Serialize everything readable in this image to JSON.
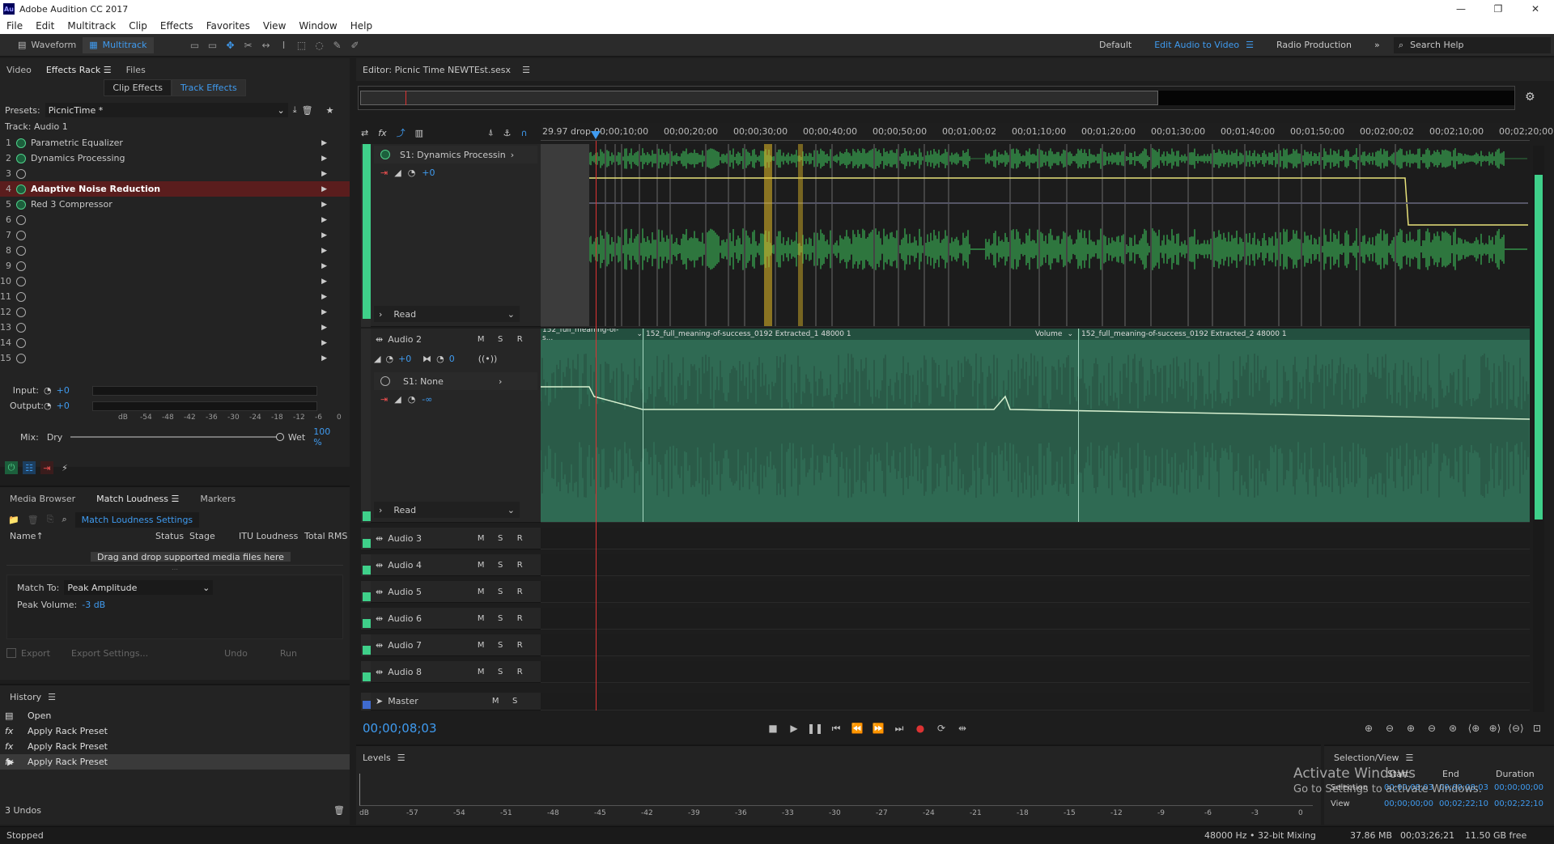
{
  "title": "Adobe Audition CC 2017",
  "window_controls": {
    "minimize": "—",
    "maximize": "❐",
    "close": "✕"
  },
  "menu": [
    "File",
    "Edit",
    "Multitrack",
    "Clip",
    "Effects",
    "Favorites",
    "View",
    "Window",
    "Help"
  ],
  "toolbar": {
    "waveform": "Waveform",
    "multitrack": "Multitrack",
    "workspaces": [
      "Default",
      "Edit Audio to Video",
      "Radio Production"
    ],
    "search_placeholder": "Search Help"
  },
  "effects_panel": {
    "tabs": [
      "Video",
      "Effects Rack",
      "Files"
    ],
    "subtabs": [
      "Clip Effects",
      "Track Effects"
    ],
    "presets_label": "Presets:",
    "preset_value": "PicnicTime *",
    "track_label": "Track: Audio 1",
    "slots": [
      {
        "n": "1",
        "name": "Parametric Equalizer",
        "on": true
      },
      {
        "n": "2",
        "name": "Dynamics Processing",
        "on": true
      },
      {
        "n": "3",
        "name": "",
        "on": false
      },
      {
        "n": "4",
        "name": "Adaptive Noise Reduction",
        "on": true,
        "selected": true
      },
      {
        "n": "5",
        "name": "Red 3 Compressor",
        "on": true
      },
      {
        "n": "6",
        "name": "",
        "on": false
      },
      {
        "n": "7",
        "name": "",
        "on": false
      },
      {
        "n": "8",
        "name": "",
        "on": false
      },
      {
        "n": "9",
        "name": "",
        "on": false
      },
      {
        "n": "10",
        "name": "",
        "on": false
      },
      {
        "n": "11",
        "name": "",
        "on": false
      },
      {
        "n": "12",
        "name": "",
        "on": false
      },
      {
        "n": "13",
        "name": "",
        "on": false
      },
      {
        "n": "14",
        "name": "",
        "on": false
      },
      {
        "n": "15",
        "name": "",
        "on": false
      }
    ],
    "input_label": "Input:",
    "input_val": "+0",
    "output_label": "Output:",
    "output_val": "+0",
    "db_scale": [
      "dB",
      "-54",
      "-48",
      "-42",
      "-36",
      "-30",
      "-24",
      "-18",
      "-12",
      "-6",
      "0"
    ],
    "mix_label": "Mix:",
    "dry": "Dry",
    "wet": "Wet",
    "wet_val": "100 %"
  },
  "loudness_panel": {
    "tabs": [
      "Media Browser",
      "Match Loudness",
      "Markers"
    ],
    "settings_btn": "Match Loudness Settings",
    "columns": [
      "Name",
      "Status",
      "Stage",
      "ITU Loudness",
      "Total RMS"
    ],
    "drop_hint": "Drag and drop supported media files here",
    "match_to_label": "Match To:",
    "match_to_value": "Peak Amplitude",
    "peak_label": "Peak Volume:",
    "peak_value": "-3 dB",
    "export": "Export",
    "export_settings": "Export Settings...",
    "undo": "Undo",
    "run": "Run"
  },
  "history": {
    "title": "History",
    "items": [
      "Open",
      "Apply Rack Preset",
      "Apply Rack Preset",
      "Apply Rack Preset"
    ],
    "undos": "3 Undos"
  },
  "editor": {
    "title": "Editor: Picnic Time NEWTEst.sesx",
    "timecode_format": "29.97 drop",
    "ruler": [
      "00;00;10;00",
      "00;00;20;00",
      "00;00;30;00",
      "00;00;40;00",
      "00;00;50;00",
      "00;01;00;02",
      "00;01;10;00",
      "00;01;20;00",
      "00;01;30;00",
      "00;01;40;00",
      "00;01;50;00",
      "00;02;00;02",
      "00;02;10;00",
      "00;02;20;00"
    ],
    "track1": {
      "fx": "S1: Dynamics Processin",
      "vol": "+0",
      "mode": "Read"
    },
    "track2": {
      "name": "Audio 2",
      "vol": "+0",
      "pan": "0",
      "fx": "S1: None",
      "fxvol": "-∞",
      "mode": "Read",
      "clips": [
        "152_full_meaning-of-s...",
        "152_full_meaning-of-success_0192 Extracted_1 48000 1",
        "152_full_meaning-of-success_0192 Extracted_2 48000 1"
      ],
      "volume_label": "Volume"
    },
    "tracks": [
      "Audio 3",
      "Audio 4",
      "Audio 5",
      "Audio 6",
      "Audio 7",
      "Audio 8"
    ],
    "master": "Master",
    "msr": [
      "M",
      "S",
      "R"
    ],
    "current_time": "00;00;08;03"
  },
  "levels": {
    "title": "Levels",
    "scale": [
      "dB",
      "-57",
      "-54",
      "-51",
      "-48",
      "-45",
      "-42",
      "-39",
      "-36",
      "-33",
      "-30",
      "-27",
      "-24",
      "-21",
      "-18",
      "-15",
      "-12",
      "-9",
      "-6",
      "-3",
      "0"
    ]
  },
  "selection": {
    "title": "Selection/View",
    "cols": [
      "Start",
      "End",
      "Duration"
    ],
    "rows": [
      {
        "label": "Selection",
        "start": "00;00;08;03",
        "end": "00;00;08;03",
        "dur": "00;00;00;00"
      },
      {
        "label": "View",
        "start": "00;00;00;00",
        "end": "00;02;22;10",
        "dur": "00;02;22;10"
      }
    ]
  },
  "watermark": {
    "line1": "Activate Windows",
    "line2": "Go to Settings to activate Windows."
  },
  "status": {
    "left": "Stopped",
    "sr": "48000 Hz • 32-bit Mixing",
    "mem": "37.86 MB",
    "dur": "00;03;26;21",
    "free": "11.50 GB free"
  },
  "colors": {
    "accent": "#3f9bf0",
    "wave": "#3fd05f",
    "clip2": "#2f6a53",
    "selrow": "#5a1d1d"
  }
}
